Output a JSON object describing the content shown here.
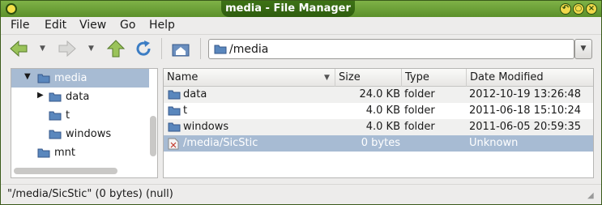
{
  "window": {
    "title": "media - File Manager"
  },
  "menubar": {
    "items": [
      "File",
      "Edit",
      "View",
      "Go",
      "Help"
    ]
  },
  "toolbar": {
    "icons": [
      "back-arrow-icon",
      "forward-arrow-icon",
      "up-arrow-icon",
      "reload-icon",
      "home-icon"
    ],
    "location_value": "/media"
  },
  "sidepane": {
    "items": [
      {
        "label": "media",
        "expanded": true,
        "selected": true
      },
      {
        "label": "data",
        "expanded": false
      },
      {
        "label": "t"
      },
      {
        "label": "windows"
      },
      {
        "label": "mnt"
      }
    ]
  },
  "filelist": {
    "columns": [
      "Name",
      "Size",
      "Type",
      "Date Modified"
    ],
    "rows": [
      {
        "name": "data",
        "size": "24.0 KB",
        "type": "folder",
        "date": "2012-10-19 13:26:48"
      },
      {
        "name": "t",
        "size": "4.0 KB",
        "type": "folder",
        "date": "2011-06-18 15:10:24"
      },
      {
        "name": "windows",
        "size": "4.0 KB",
        "type": "folder",
        "date": "2011-06-05 20:59:35"
      },
      {
        "name": "/media/SicStic",
        "size": "0 bytes",
        "type": "",
        "date": "Unknown"
      }
    ]
  },
  "statusbar": {
    "text": "\"/media/SicStic\" (0 bytes) (null)"
  },
  "colors": {
    "titlebar": "#6a9a3a",
    "selection": "#a7bbd3",
    "folder": "#4f7fb6"
  }
}
